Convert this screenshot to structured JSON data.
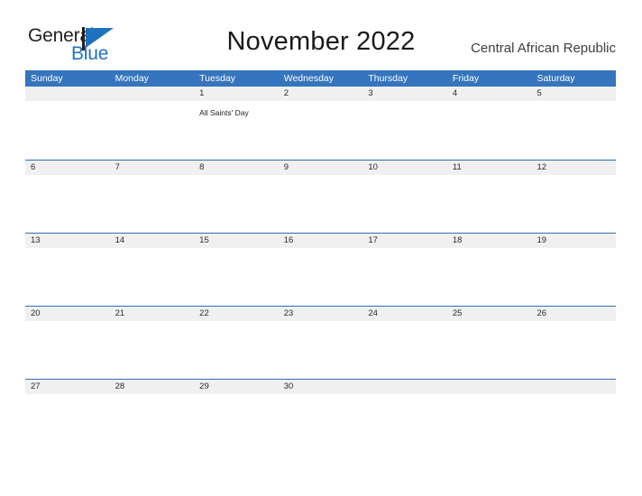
{
  "brand": {
    "name_part1": "General",
    "name_part2": "Blue",
    "flag_icon": "flag-triangle-icon",
    "accent_color": "#1e73be"
  },
  "header": {
    "title": "November 2022",
    "country": "Central African Republic"
  },
  "calendar": {
    "header_bg_color": "#3575bd",
    "row_band_color": "#f0f0f0",
    "rule_color": "#2f6fb5",
    "weekdays": [
      "Sunday",
      "Monday",
      "Tuesday",
      "Wednesday",
      "Thursday",
      "Friday",
      "Saturday"
    ],
    "weeks": [
      {
        "has_top_rule": false,
        "days": [
          {
            "number": "",
            "event": ""
          },
          {
            "number": "",
            "event": ""
          },
          {
            "number": "1",
            "event": "All Saints' Day"
          },
          {
            "number": "2",
            "event": ""
          },
          {
            "number": "3",
            "event": ""
          },
          {
            "number": "4",
            "event": ""
          },
          {
            "number": "5",
            "event": ""
          }
        ]
      },
      {
        "has_top_rule": true,
        "days": [
          {
            "number": "6",
            "event": ""
          },
          {
            "number": "7",
            "event": ""
          },
          {
            "number": "8",
            "event": ""
          },
          {
            "number": "9",
            "event": ""
          },
          {
            "number": "10",
            "event": ""
          },
          {
            "number": "11",
            "event": ""
          },
          {
            "number": "12",
            "event": ""
          }
        ]
      },
      {
        "has_top_rule": true,
        "days": [
          {
            "number": "13",
            "event": ""
          },
          {
            "number": "14",
            "event": ""
          },
          {
            "number": "15",
            "event": ""
          },
          {
            "number": "16",
            "event": ""
          },
          {
            "number": "17",
            "event": ""
          },
          {
            "number": "18",
            "event": ""
          },
          {
            "number": "19",
            "event": ""
          }
        ]
      },
      {
        "has_top_rule": true,
        "days": [
          {
            "number": "20",
            "event": ""
          },
          {
            "number": "21",
            "event": ""
          },
          {
            "number": "22",
            "event": ""
          },
          {
            "number": "23",
            "event": ""
          },
          {
            "number": "24",
            "event": ""
          },
          {
            "number": "25",
            "event": ""
          },
          {
            "number": "26",
            "event": ""
          }
        ]
      },
      {
        "has_top_rule": true,
        "days": [
          {
            "number": "27",
            "event": ""
          },
          {
            "number": "28",
            "event": ""
          },
          {
            "number": "29",
            "event": ""
          },
          {
            "number": "30",
            "event": ""
          },
          {
            "number": "",
            "event": ""
          },
          {
            "number": "",
            "event": ""
          },
          {
            "number": "",
            "event": ""
          }
        ]
      }
    ]
  }
}
